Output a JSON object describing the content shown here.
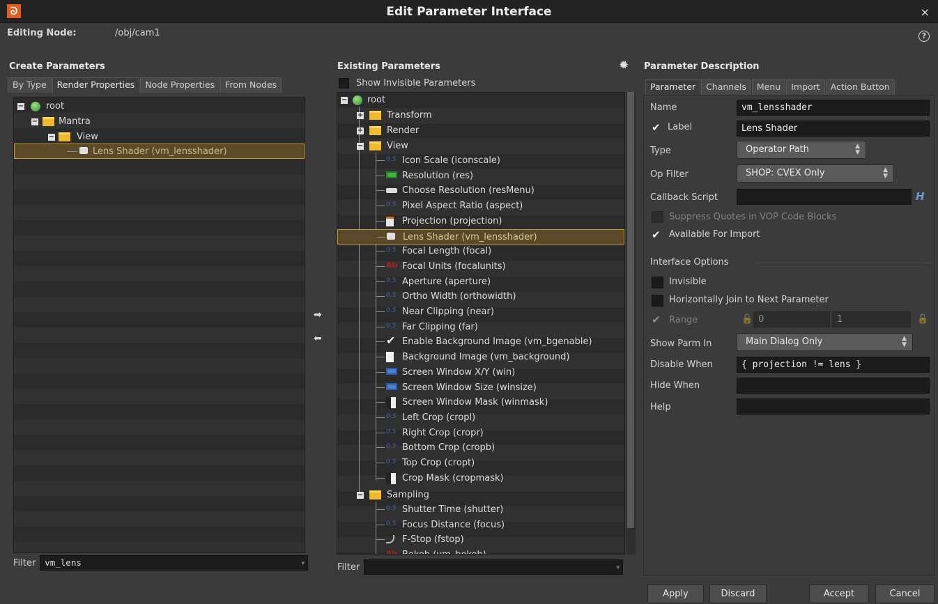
{
  "window": {
    "title": "Edit Parameter Interface",
    "logo": "houdini-logo-icon",
    "close": "×"
  },
  "editing": {
    "label": "Editing Node:",
    "path": "/obj/cam1",
    "help": "?"
  },
  "create_panel": {
    "heading": "Create Parameters",
    "tabs": [
      "By Type",
      "Render Properties",
      "Node Properties",
      "From Nodes"
    ],
    "active_tab": 1,
    "tree": [
      "root",
      "Mantra",
      "View",
      "Lens Shader (vm_lensshader)"
    ],
    "filter_label": "Filter",
    "filter_value": "vm_lens"
  },
  "existing_panel": {
    "heading": "Existing Parameters",
    "show_invisible": "Show Invisible Parameters",
    "root": "root",
    "folders": {
      "transform": "Transform",
      "render": "Render",
      "view": "View",
      "sampling": "Sampling"
    },
    "view_items": [
      {
        "label": "Icon Scale (iconscale)",
        "icon": "float-icon"
      },
      {
        "label": "Resolution (res)",
        "icon": "int-vector-icon"
      },
      {
        "label": "Choose Resolution (resMenu)",
        "icon": "button-icon"
      },
      {
        "label": "Pixel Aspect Ratio (aspect)",
        "icon": "float-icon"
      },
      {
        "label": "Projection (projection)",
        "icon": "ordinal-menu-icon"
      },
      {
        "label": "Lens Shader (vm_lensshader)",
        "icon": "oppath-icon"
      },
      {
        "label": "Focal Length (focal)",
        "icon": "float-icon"
      },
      {
        "label": "Focal Units (focalunits)",
        "icon": "string-icon"
      },
      {
        "label": "Aperture (aperture)",
        "icon": "float-icon"
      },
      {
        "label": "Ortho Width (orthowidth)",
        "icon": "float-icon"
      },
      {
        "label": "Near Clipping (near)",
        "icon": "float-icon"
      },
      {
        "label": "Far Clipping (far)",
        "icon": "float-icon"
      },
      {
        "label": "Enable Background Image (vm_bgenable)",
        "icon": "toggle-icon"
      },
      {
        "label": "Background Image (vm_background)",
        "icon": "file-icon"
      },
      {
        "label": "Screen Window X/Y (win)",
        "icon": "float-vector-icon"
      },
      {
        "label": "Screen Window Size (winsize)",
        "icon": "float-vector-icon"
      },
      {
        "label": "Screen Window Mask (winmask)",
        "icon": "mask-icon"
      },
      {
        "label": "Left Crop (cropl)",
        "icon": "float-icon"
      },
      {
        "label": "Right Crop (cropr)",
        "icon": "float-icon"
      },
      {
        "label": "Bottom Crop (cropb)",
        "icon": "float-icon"
      },
      {
        "label": "Top Crop (cropt)",
        "icon": "float-icon"
      },
      {
        "label": "Crop Mask (cropmask)",
        "icon": "mask-icon"
      }
    ],
    "sampling_items": [
      {
        "label": "Shutter Time (shutter)",
        "icon": "float-icon"
      },
      {
        "label": "Focus Distance (focus)",
        "icon": "float-icon"
      },
      {
        "label": "F-Stop (fstop)",
        "icon": "ramp-icon"
      },
      {
        "label": "Bokeh (vm_bokeh)",
        "icon": "string-icon"
      }
    ],
    "selected_index": 5,
    "filter_label": "Filter",
    "filter_value": ""
  },
  "desc_panel": {
    "heading": "Parameter Description",
    "tabs": [
      "Parameter",
      "Channels",
      "Menu",
      "Import",
      "Action Button"
    ],
    "active_tab": 0,
    "name_label": "Name",
    "name_value": "vm_lensshader",
    "label_label": "Label",
    "label_value": "Lens Shader",
    "type_label": "Type",
    "type_value": "Operator Path",
    "opfilter_label": "Op Filter",
    "opfilter_value": "SHOP: CVEX Only",
    "callback_label": "Callback Script",
    "callback_value": "",
    "suppress_label": "Suppress Quotes in VOP Code Blocks",
    "import_label": "Available For Import",
    "interface_label": "Interface Options",
    "invisible_label": "Invisible",
    "hjoin_label": "Horizontally Join to Next Parameter",
    "range_label": "Range",
    "range_min": "0",
    "range_max": "1",
    "showparm_label": "Show Parm In",
    "showparm_value": "Main Dialog Only",
    "disable_label": "Disable When",
    "disable_value": "{ projection != lens }",
    "hide_label": "Hide When",
    "hide_value": "",
    "help_label": "Help",
    "help_value": ""
  },
  "buttons": {
    "apply": "Apply",
    "discard": "Discard",
    "accept": "Accept",
    "cancel": "Cancel"
  }
}
